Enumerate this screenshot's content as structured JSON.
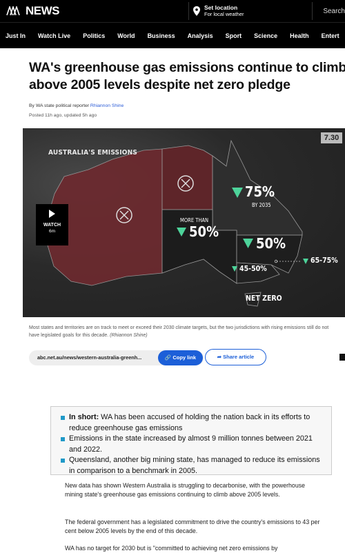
{
  "header": {
    "logo_text": "NEWS",
    "location_title": "Set location",
    "location_sub": "For local weather",
    "search_label": "Search"
  },
  "nav": [
    "Just In",
    "Watch Live",
    "Politics",
    "World",
    "Business",
    "Analysis",
    "Sport",
    "Science",
    "Health",
    "Entert"
  ],
  "article": {
    "headline": "WA's greenhouse gas emissions continue to climb above 2005 levels despite net zero pledge",
    "byline_prefix": "By WA state political reporter ",
    "byline_author": "Rhiannon Shine",
    "posted": "Posted 11h ago, updated 5h ago"
  },
  "hero": {
    "badge": "7.30",
    "title": "AUSTRALIA'S EMISSIONS",
    "watch_label": "WATCH",
    "watch_duration": "6m",
    "nt_value": "75%",
    "nt_sub": "BY 2035",
    "sa_prefix": "MORE THAN",
    "sa_value": "50%",
    "nsw_value": "50%",
    "vic_value": "45-50%",
    "act_value": "65-75%",
    "net_zero": "NET ZERO",
    "colors": {
      "wa": "#6b2a2f",
      "nt": "#6b2a2f",
      "green": "#4dd39a"
    }
  },
  "caption": "Most states and territories are on track to meet or exceed their 2030 climate targets, but the two jurisdictions with rising emissions still do not have legislated goals for this decade.",
  "caption_credit": "(Rhiannon Shine)",
  "share": {
    "url": "abc.net.au/news/western-australia-greenh...",
    "copy_label": "Copy link",
    "share_label": "Share article"
  },
  "in_short": {
    "lead": "In short:",
    "items": [
      " WA has been accused of holding the nation back in its efforts to reduce greenhouse gas emissions",
      "Emissions in the state increased by almost 9 million tonnes between 2021 and 2022.",
      "Queensland, another big mining state, has managed to reduce its emissions in comparison to a benchmark in 2005."
    ]
  },
  "body": [
    "New data has shown Western Australia is struggling to decarbonise, with the powerhouse mining state's greenhouse gas emissions continuing to climb above 2005 levels.",
    "The federal government has a legislated commitment to drive the country's emissions to 43 per cent below 2005 levels by the end of this decade.",
    "WA has no target for 2030 but is \"committed to achieving net zero emissions by"
  ]
}
